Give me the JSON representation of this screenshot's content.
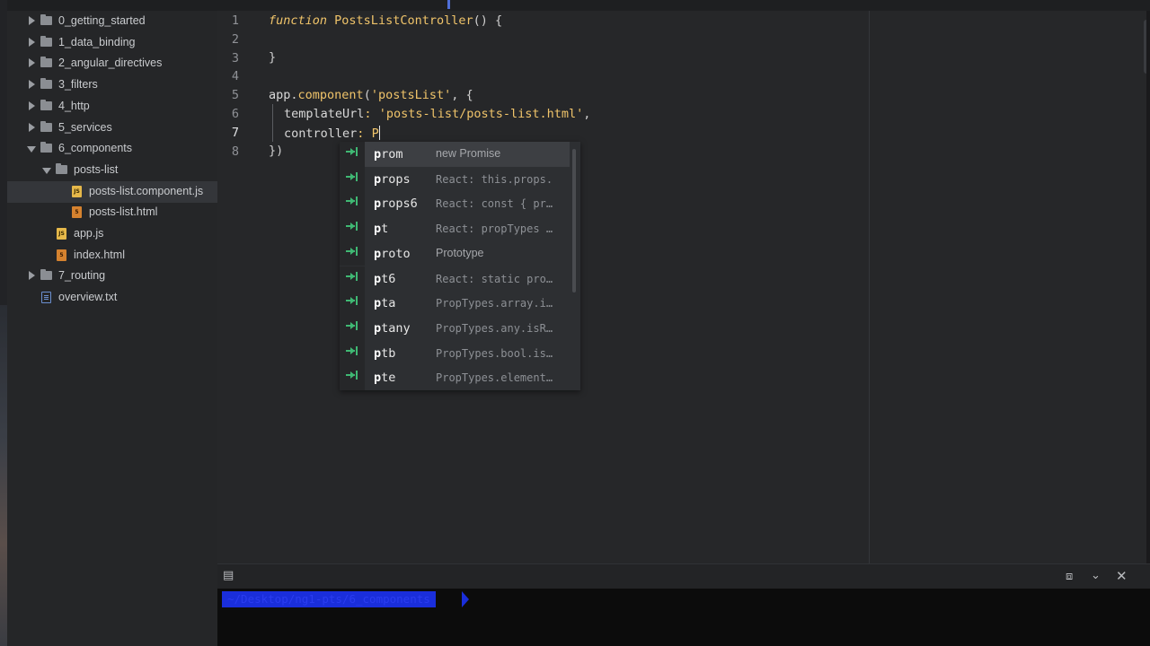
{
  "sidebar": {
    "items": [
      {
        "label": "0_getting_started",
        "kind": "folder",
        "expanded": false,
        "depth": 0
      },
      {
        "label": "1_data_binding",
        "kind": "folder",
        "expanded": false,
        "depth": 0
      },
      {
        "label": "2_angular_directives",
        "kind": "folder",
        "expanded": false,
        "depth": 0
      },
      {
        "label": "3_filters",
        "kind": "folder",
        "expanded": false,
        "depth": 0
      },
      {
        "label": "4_http",
        "kind": "folder",
        "expanded": false,
        "depth": 0
      },
      {
        "label": "5_services",
        "kind": "folder",
        "expanded": false,
        "depth": 0
      },
      {
        "label": "6_components",
        "kind": "folder",
        "expanded": true,
        "depth": 0
      },
      {
        "label": "posts-list",
        "kind": "folder",
        "expanded": true,
        "depth": 1
      },
      {
        "label": "posts-list.component.js",
        "kind": "js",
        "depth": 2,
        "selected": true
      },
      {
        "label": "posts-list.html",
        "kind": "html",
        "depth": 2
      },
      {
        "label": "app.js",
        "kind": "js",
        "depth": 1
      },
      {
        "label": "index.html",
        "kind": "html",
        "depth": 1
      },
      {
        "label": "7_routing",
        "kind": "folder",
        "expanded": false,
        "depth": 0
      },
      {
        "label": "overview.txt",
        "kind": "txt",
        "depth": 0
      }
    ],
    "file_badges": {
      "js": "JS",
      "html": "5"
    }
  },
  "editor": {
    "current_line": 7,
    "line_numbers": [
      "1",
      "2",
      "3",
      "4",
      "5",
      "6",
      "7",
      "8"
    ],
    "lines": {
      "l1": {
        "kw": "function",
        "name": "PostsListController",
        "rest": "() {"
      },
      "l3": {
        "text": "}"
      },
      "l5": {
        "obj": "app",
        "dot": ".",
        "method": "component",
        "open": "(",
        "str": "'postsList'",
        "rest": ", {"
      },
      "l6": {
        "key": "templateUrl",
        "colon": ":",
        "str": "'posts-list/posts-list.html'",
        "rest": ","
      },
      "l7": {
        "key": "controller",
        "colon": ":",
        "typed": "P"
      },
      "l8": {
        "text": "})"
      }
    }
  },
  "autocomplete": {
    "items": [
      {
        "word": "prom",
        "match": "p",
        "desc": "new Promise",
        "selected": true
      },
      {
        "word": "props",
        "match": "p",
        "desc": "React: this.props."
      },
      {
        "word": "props6",
        "match": "p",
        "desc": "React: const { pr…"
      },
      {
        "word": "pt",
        "match": "p",
        "desc": "React: propTypes …"
      },
      {
        "word": "proto",
        "match": "p",
        "desc": "Prototype"
      },
      {
        "word": "pt6",
        "match": "p",
        "desc": "React: static pro…"
      },
      {
        "word": "pta",
        "match": "p",
        "desc": "PropTypes.array.i…"
      },
      {
        "word": "ptany",
        "match": "p",
        "desc": "PropTypes.any.isR…"
      },
      {
        "word": "ptb",
        "match": "p",
        "desc": "PropTypes.bool.is…"
      },
      {
        "word": "pte",
        "match": "p",
        "desc": "PropTypes.element…"
      }
    ]
  },
  "terminal": {
    "prompt": "~/Desktop/ng1-pts/6_components"
  },
  "icons": {
    "terminal_toggle": "terminal-icon",
    "maximize": "maximize-icon",
    "hide": "chevron-down-icon",
    "close": "close-icon"
  },
  "colors": {
    "keyword": "#f0c46a",
    "string": "#f0c46a",
    "snippet_icon": "#3fb873",
    "prompt_bg": "#1a2edb"
  }
}
